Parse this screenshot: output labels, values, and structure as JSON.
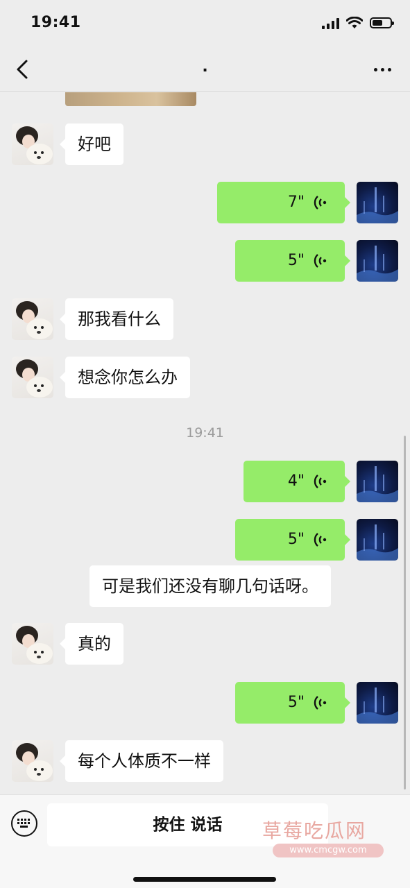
{
  "status_bar": {
    "time": "19:41"
  },
  "nav": {
    "title": "."
  },
  "messages": [
    {
      "side": "left",
      "text": "好吧"
    },
    {
      "side": "right",
      "duration": "7\""
    },
    {
      "side": "right",
      "duration": "5\""
    },
    {
      "side": "left",
      "text": "那我看什么"
    },
    {
      "side": "left",
      "text": "想念你怎么办"
    },
    {
      "timestamp": "19:41"
    },
    {
      "side": "right",
      "duration": "4\""
    },
    {
      "side": "right",
      "duration": "5\"",
      "transcript": "可是我们还没有聊几句话呀。"
    },
    {
      "side": "left",
      "text": "真的"
    },
    {
      "side": "right",
      "duration": "5\""
    },
    {
      "side": "left",
      "text": "每个人体质不一样"
    }
  ],
  "input_bar": {
    "hold_to_talk": "按住 说话"
  },
  "watermark": {
    "text": "草莓吃瓜网",
    "url": "www.cmcgw.com"
  }
}
